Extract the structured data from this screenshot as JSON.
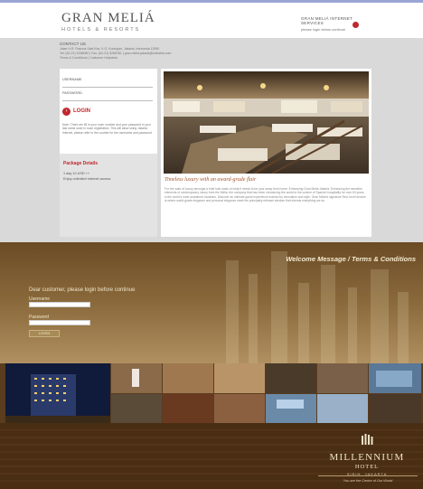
{
  "gran_melia": {
    "logo_line1": "GRAN MELIÁ",
    "logo_line2": "HOTELS & RESORTS",
    "services_title": "GRAN MELIÁ INTERNET SERVICES",
    "services_link": "please login below continue",
    "contact": {
      "title": "CONTACT US",
      "address": "Jalan H.R. Rasuna Said Kav. X-O, Kuningan, Jakarta, Indonesia 12950",
      "phone": "Tel: (62-21) 5268080 | Fax: (62-21) 5268181 | gran.melia.jakarta@solmelia.com",
      "terms": "Terms & Conditions | Customer Helpdesk"
    },
    "form": {
      "username_label": "USERNAME",
      "password_label": "PASSWORD",
      "login_label": "LOGIN",
      "note": "Note: There are fill in your room number and your password in your last name used in room registration. This will allow using Jakarta Internet, please refer to the counter for the username and password."
    },
    "package": {
      "title": "Package Details",
      "line1": "1 day 10 USD ++",
      "line2": "Enjoy unlimited internet access"
    },
    "headline": "Timeless luxury with an award-grade flair",
    "description": "For the sake of luxury amongst a brief lush oasis of what it needs to be your away from home. Embracing Gran Melia Jakarta. Enhancing the sensitive elements of contemporary luxury from the Melia, the company that has been introducing the world to the cuisine of Spanish hospitality for over 60 years in the world's most acclaimed locations. Discover an intimate guest experience marked by innovation and style. Gran Melia's signature Red Level service is where world-grade elegance and personal elegance meet the principally relevant wisdom that intends everything we do.",
    "colors": {
      "accent": "#c0282d",
      "headline": "#a0522d",
      "background": "#d9d9d9"
    }
  },
  "millennium": {
    "welcome_link": "Welcome Message / Terms & Conditions",
    "greeting": "Dear customer, please login before continue",
    "username_label": "Username",
    "password_label": "Password",
    "login_button": "LOGIN",
    "brand": "MILLENNIUM",
    "brand_sub": "HOTEL",
    "location": "SIRIH, JAKARTA",
    "tagline": "You are the Centre of Our World",
    "colors": {
      "background": "#5a3d1f",
      "text": "#f0e6cc",
      "gold": "#b59c6b"
    }
  }
}
